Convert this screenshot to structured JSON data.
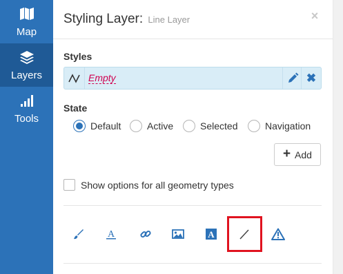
{
  "sidebar": {
    "items": [
      {
        "label": "Map",
        "icon": "map-icon",
        "active": false
      },
      {
        "label": "Layers",
        "icon": "layers-icon",
        "active": true
      },
      {
        "label": "Tools",
        "icon": "signal-bars-icon",
        "active": false
      }
    ]
  },
  "panel": {
    "title": "Styling Layer:",
    "subtitle": "Line Layer",
    "close_label": "×"
  },
  "styles": {
    "label": "Styles",
    "current": {
      "name": "Empty",
      "geometry_icon": "line-geometry-icon"
    },
    "delete_label": "✖"
  },
  "state": {
    "label": "State",
    "options": [
      "Default",
      "Active",
      "Selected",
      "Navigation"
    ],
    "selected": "Default"
  },
  "add_button": {
    "label": "Add"
  },
  "show_all_option": {
    "label": "Show options for all geometry types",
    "checked": false
  },
  "toolbar": {
    "icons": [
      "brush-icon",
      "text-font-icon",
      "link-icon",
      "image-icon",
      "text-box-icon",
      "line-icon",
      "warning-icon"
    ],
    "highlighted": "line-icon"
  },
  "colors": {
    "sidebar": "#2c72b8",
    "sidebar_active": "#1f5a96",
    "accent": "#2c72b8",
    "style_row_bg": "#d9edf7",
    "empty_text": "#d0004f",
    "highlight": "#e0131f"
  }
}
